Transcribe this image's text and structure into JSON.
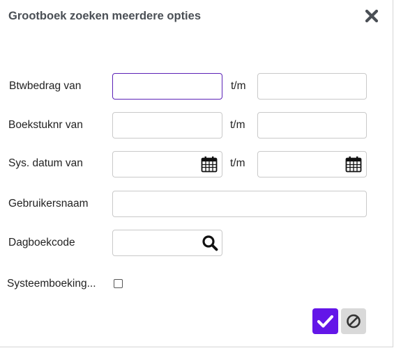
{
  "dialog": {
    "title": "Grootboek zoeken meerdere opties",
    "close_icon": "close-icon"
  },
  "form": {
    "btwbedrag_label": "Btwbedrag van",
    "btwbedrag_from": "",
    "btwbedrag_to": "",
    "boekstuknr_label": "Boekstuknr van",
    "boekstuknr_from": "",
    "boekstuknr_to": "",
    "sysdatum_label": "Sys. datum van",
    "sysdatum_from": "",
    "sysdatum_to": "",
    "range_separator": "t/m",
    "gebruikersnaam_label": "Gebruikersnaam",
    "gebruikersnaam_value": "",
    "dagboekcode_label": "Dagboekcode",
    "dagboekcode_value": "",
    "systeemboeking_label": "Systeemboeking...",
    "systeemboeking_checked": false
  },
  "buttons": {
    "confirm_icon": "check-icon",
    "cancel_icon": "cancel-icon"
  },
  "colors": {
    "accent": "#6316e8",
    "focus_border": "#5b21b6",
    "title": "#4a4f55"
  }
}
